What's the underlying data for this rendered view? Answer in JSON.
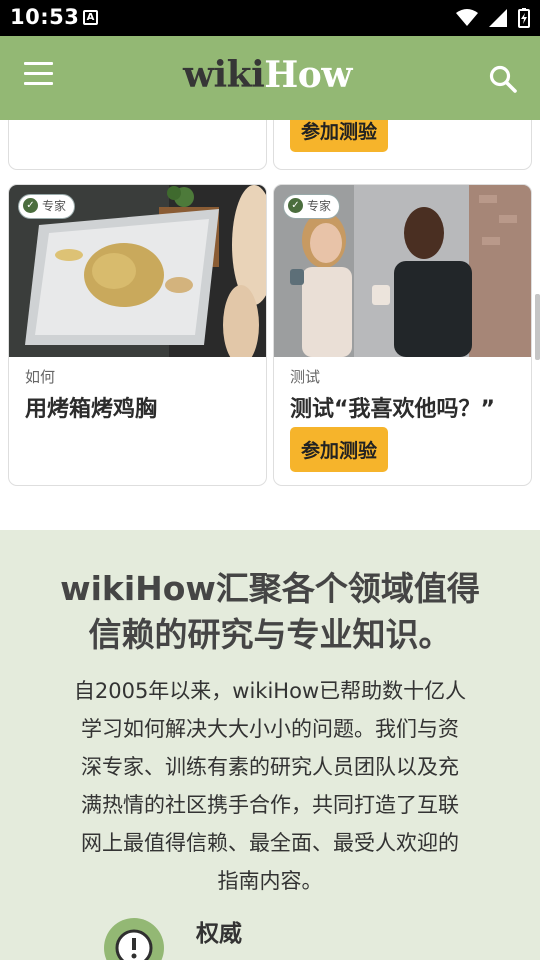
{
  "status_bar": {
    "time": "10:53",
    "badge": "A"
  },
  "app_bar": {
    "logo_wiki": "wiki",
    "logo_how": "How"
  },
  "cards": {
    "top_right": {
      "button": "参加测验"
    },
    "left": {
      "badge": "专家",
      "type": "如何",
      "title": "用烤箱烤鸡胸"
    },
    "right": {
      "badge": "专家",
      "type": "测试",
      "title": "测试“我喜欢他吗？”",
      "button": "参加测验"
    }
  },
  "info": {
    "title_line1": "wikiHow汇聚各个领域值得",
    "title_line2": "信赖的研究与专业知识。",
    "body_lines": [
      "自2005年以来，wikiHow已帮助数十亿人",
      "学习如何解决大大小小的问题。我们与资",
      "深专家、训练有素的研究人员团队以及充",
      "满热情的社区携手合作，共同打造了互联",
      "网上最值得信赖、最全面、最受人欢迎的",
      "指南内容。"
    ],
    "authority_title": "权威"
  },
  "colors": {
    "appbar": "#93b874",
    "button": "#f6b42b",
    "info_bg": "#e4ebdc"
  }
}
